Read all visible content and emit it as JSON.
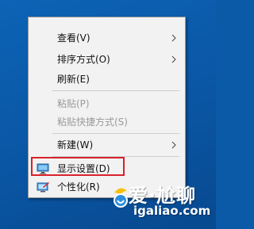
{
  "context_menu": {
    "items": [
      {
        "label": "查看(V)",
        "has_submenu": true,
        "disabled": false
      },
      {
        "label": "排序方式(O)",
        "has_submenu": true,
        "disabled": false
      },
      {
        "label": "刷新(E)",
        "has_submenu": false,
        "disabled": false
      },
      {
        "label": "粘贴(P)",
        "has_submenu": false,
        "disabled": true
      },
      {
        "label": "粘贴快捷方式(S)",
        "has_submenu": false,
        "disabled": true
      },
      {
        "label": "新建(W)",
        "has_submenu": true,
        "disabled": false
      },
      {
        "label": "显示设置(D)",
        "has_submenu": false,
        "disabled": false,
        "icon": "display-icon",
        "highlighted": true
      },
      {
        "label": "个性化(R)",
        "has_submenu": false,
        "disabled": false,
        "icon": "personalize-icon"
      }
    ]
  },
  "watermark": {
    "text": "爱·尬聊",
    "domain": "igaliao.com"
  },
  "colors": {
    "desktop": "#0a5aa8",
    "menu_bg": "#f2f2f2",
    "highlight_border": "#d8222a",
    "disabled_text": "#9a9a9a"
  }
}
